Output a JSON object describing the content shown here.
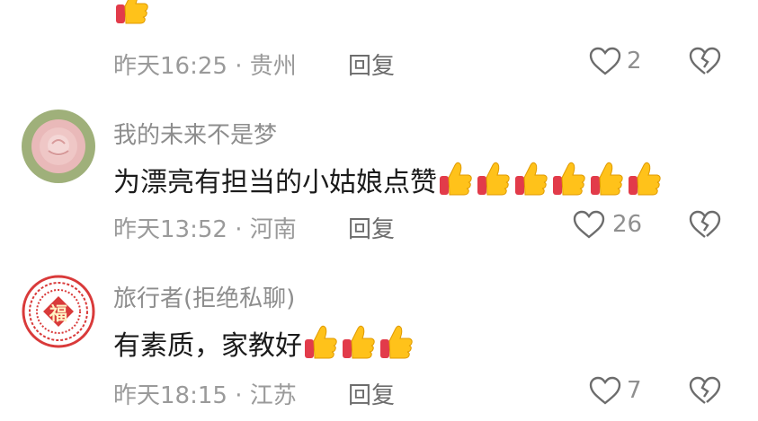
{
  "comments": [
    {
      "meta": "昨天16:25 · 贵州",
      "reply_label": "回复",
      "like_count": "2"
    },
    {
      "username": "我的未来不是梦",
      "text": "为漂亮有担当的小姑娘点赞",
      "thumbs_up_emoji_count": 6,
      "meta": "昨天13:52 · 河南",
      "reply_label": "回复",
      "like_count": "26"
    },
    {
      "username": "旅行者(拒绝私聊)",
      "text": "有素质，家教好",
      "thumbs_up_emoji_count": 3,
      "meta": "昨天18:15 · 江苏",
      "reply_label": "回复",
      "like_count": "7",
      "avatar_text": "福"
    }
  ]
}
